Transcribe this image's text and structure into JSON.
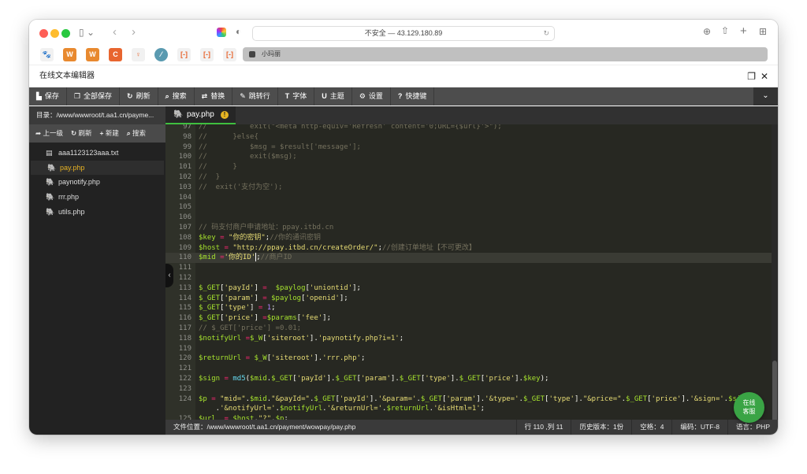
{
  "browser": {
    "url": "不安全 — 43.129.180.89",
    "tab_title": "小玛丽",
    "bookmarks": [
      "baidu",
      "W",
      "W",
      "C",
      "lightbulb",
      "code",
      "[-]",
      "[-]",
      "[-]"
    ]
  },
  "app": {
    "title": "在线文本编辑器"
  },
  "toolbar": [
    {
      "icon": "save-icon",
      "glyph": "▙",
      "label": "保存"
    },
    {
      "icon": "save-all-icon",
      "glyph": "❐",
      "label": "全部保存"
    },
    {
      "icon": "refresh-icon",
      "glyph": "↻",
      "label": "刷新"
    },
    {
      "icon": "search-icon",
      "glyph": "⌕",
      "label": "搜索"
    },
    {
      "icon": "replace-icon",
      "glyph": "⇄",
      "label": "替换"
    },
    {
      "icon": "goto-line-icon",
      "glyph": "✎",
      "label": "跳转行"
    },
    {
      "icon": "font-icon",
      "glyph": "T",
      "label": "字体"
    },
    {
      "icon": "theme-icon",
      "glyph": "U",
      "label": "主题"
    },
    {
      "icon": "settings-icon",
      "glyph": "⚙",
      "label": "设置"
    },
    {
      "icon": "shortcut-icon",
      "glyph": "?",
      "label": "快捷键"
    }
  ],
  "sidebar": {
    "path": "目录：/www/wwwroot/t.aa1.cn/payme...",
    "actions": [
      {
        "glyph": "➦",
        "label": "上一级"
      },
      {
        "glyph": "↻",
        "label": "刷新"
      },
      {
        "glyph": "+",
        "label": "新建"
      },
      {
        "glyph": "⌕",
        "label": "搜索"
      }
    ],
    "files": [
      {
        "name": "aaa1123123aaa.txt",
        "type": "txt"
      },
      {
        "name": "pay.php",
        "type": "php",
        "active": true
      },
      {
        "name": "paynotify.php",
        "type": "php"
      },
      {
        "name": "rrr.php",
        "type": "php"
      },
      {
        "name": "utils.php",
        "type": "php"
      }
    ]
  },
  "editor": {
    "tab": "pay.php",
    "current_line": 110,
    "lines": [
      {
        "n": "97",
        "t": [
          [
            "c",
            "//          exit(\"<meta http-equiv='Refresh' content='0;URL={$url}'>\");"
          ]
        ]
      },
      {
        "n": "98",
        "t": [
          [
            "c",
            "//      }else{"
          ]
        ]
      },
      {
        "n": "99",
        "t": [
          [
            "c",
            "//          $msg = $result['message'];"
          ]
        ]
      },
      {
        "n": "100",
        "t": [
          [
            "c",
            "//          exit($msg);"
          ]
        ]
      },
      {
        "n": "101",
        "t": [
          [
            "c",
            "//      }"
          ]
        ]
      },
      {
        "n": "102",
        "t": [
          [
            "c",
            "//  }"
          ]
        ]
      },
      {
        "n": "103",
        "t": [
          [
            "c",
            "//  exit('支付为空');"
          ]
        ]
      },
      {
        "n": "104",
        "t": []
      },
      {
        "n": "105",
        "t": []
      },
      {
        "n": "106",
        "t": []
      },
      {
        "n": "107",
        "t": [
          [
            "c",
            "// 码支付商户申请地址：ppay.itbd.cn"
          ]
        ]
      },
      {
        "n": "108",
        "t": [
          [
            "v",
            "$key"
          ],
          [
            "o",
            " = "
          ],
          [
            "s",
            "\"你的密钥\""
          ],
          [
            "p",
            ";"
          ],
          [
            "c",
            "//你的通讯密钥"
          ]
        ]
      },
      {
        "n": "109",
        "t": [
          [
            "v",
            "$host"
          ],
          [
            "o",
            " = "
          ],
          [
            "s",
            "\"http://ppay.itbd.cn/createOrder/\""
          ],
          [
            "p",
            ";"
          ],
          [
            "c",
            "//创建订单地址【不可更改】"
          ]
        ]
      },
      {
        "n": "110",
        "t": [
          [
            "v",
            "$mid"
          ],
          [
            "o",
            " ="
          ],
          [
            "s",
            "'你的ID'"
          ],
          [
            "cur",
            ""
          ],
          [
            "p",
            ";"
          ],
          [
            "c",
            "//商户ID"
          ]
        ]
      },
      {
        "n": "111",
        "t": []
      },
      {
        "n": "112",
        "t": []
      },
      {
        "n": "113",
        "t": [
          [
            "v",
            "$_GET"
          ],
          [
            "p",
            "["
          ],
          [
            "s",
            "'payId'"
          ],
          [
            "p",
            "]"
          ],
          [
            "o",
            " =  "
          ],
          [
            "v",
            "$paylog"
          ],
          [
            "p",
            "["
          ],
          [
            "s",
            "'uniontid'"
          ],
          [
            "p",
            "];"
          ]
        ]
      },
      {
        "n": "114",
        "t": [
          [
            "v",
            "$_GET"
          ],
          [
            "p",
            "["
          ],
          [
            "s",
            "'param'"
          ],
          [
            "p",
            "]"
          ],
          [
            "o",
            " = "
          ],
          [
            "v",
            "$paylog"
          ],
          [
            "p",
            "["
          ],
          [
            "s",
            "'openid'"
          ],
          [
            "p",
            "];"
          ]
        ]
      },
      {
        "n": "115",
        "t": [
          [
            "v",
            "$_GET"
          ],
          [
            "p",
            "["
          ],
          [
            "s",
            "'type'"
          ],
          [
            "p",
            "]"
          ],
          [
            "o",
            " = "
          ],
          [
            "n",
            "1"
          ],
          [
            "p",
            ";"
          ]
        ]
      },
      {
        "n": "116",
        "t": [
          [
            "v",
            "$_GET"
          ],
          [
            "p",
            "["
          ],
          [
            "s",
            "'price'"
          ],
          [
            "p",
            "]"
          ],
          [
            "o",
            " ="
          ],
          [
            "v",
            "$params"
          ],
          [
            "p",
            "["
          ],
          [
            "s",
            "'fee'"
          ],
          [
            "p",
            "];"
          ]
        ]
      },
      {
        "n": "117",
        "t": [
          [
            "c",
            "// $_GET['price'] =0.01;"
          ]
        ]
      },
      {
        "n": "118",
        "t": [
          [
            "v",
            "$notifyUrl"
          ],
          [
            "o",
            " ="
          ],
          [
            "v",
            "$_W"
          ],
          [
            "p",
            "["
          ],
          [
            "s",
            "'siteroot'"
          ],
          [
            "p",
            "]."
          ],
          [
            "s",
            "'paynotify.php?i=1'"
          ],
          [
            "p",
            ";"
          ]
        ]
      },
      {
        "n": "119",
        "t": []
      },
      {
        "n": "120",
        "t": [
          [
            "v",
            "$returnUrl"
          ],
          [
            "o",
            " = "
          ],
          [
            "v",
            "$_W"
          ],
          [
            "p",
            "["
          ],
          [
            "s",
            "'siteroot'"
          ],
          [
            "p",
            "]."
          ],
          [
            "s",
            "'rrr.php'"
          ],
          [
            "p",
            ";"
          ]
        ]
      },
      {
        "n": "121",
        "t": []
      },
      {
        "n": "122",
        "t": [
          [
            "v",
            "$sign"
          ],
          [
            "o",
            " = "
          ],
          [
            "f",
            "md5"
          ],
          [
            "p",
            "("
          ],
          [
            "v",
            "$mid"
          ],
          [
            "p",
            "."
          ],
          [
            "v",
            "$_GET"
          ],
          [
            "p",
            "["
          ],
          [
            "s",
            "'payId'"
          ],
          [
            "p",
            "]."
          ],
          [
            "v",
            "$_GET"
          ],
          [
            "p",
            "["
          ],
          [
            "s",
            "'param'"
          ],
          [
            "p",
            "]."
          ],
          [
            "v",
            "$_GET"
          ],
          [
            "p",
            "["
          ],
          [
            "s",
            "'type'"
          ],
          [
            "p",
            "]."
          ],
          [
            "v",
            "$_GET"
          ],
          [
            "p",
            "["
          ],
          [
            "s",
            "'price'"
          ],
          [
            "p",
            "]."
          ],
          [
            "v",
            "$key"
          ],
          [
            "p",
            ");"
          ]
        ]
      },
      {
        "n": "123",
        "t": []
      },
      {
        "n": "124",
        "t": [
          [
            "v",
            "$p"
          ],
          [
            "o",
            " = "
          ],
          [
            "s",
            "\"mid=\""
          ],
          [
            "p",
            "."
          ],
          [
            "v",
            "$mid"
          ],
          [
            "p",
            "."
          ],
          [
            "s",
            "\"&payId=\""
          ],
          [
            "p",
            "."
          ],
          [
            "v",
            "$_GET"
          ],
          [
            "p",
            "["
          ],
          [
            "s",
            "'payId'"
          ],
          [
            "p",
            "]."
          ],
          [
            "s",
            "'&param='"
          ],
          [
            "p",
            "."
          ],
          [
            "v",
            "$_GET"
          ],
          [
            "p",
            "["
          ],
          [
            "s",
            "'param'"
          ],
          [
            "p",
            "]."
          ],
          [
            "s",
            "'&type='"
          ],
          [
            "p",
            "."
          ],
          [
            "v",
            "$_GET"
          ],
          [
            "p",
            "["
          ],
          [
            "s",
            "'type'"
          ],
          [
            "p",
            "]."
          ],
          [
            "s",
            "\"&price=\""
          ],
          [
            "p",
            "."
          ],
          [
            "v",
            "$_GET"
          ],
          [
            "p",
            "["
          ],
          [
            "s",
            "'price'"
          ],
          [
            "p",
            "]."
          ],
          [
            "s",
            "'&sign='"
          ],
          [
            "p",
            "."
          ],
          [
            "v",
            "$sign"
          ]
        ]
      },
      {
        "n": "",
        "t": [
          [
            "p",
            "    ."
          ],
          [
            "s",
            "'&notifyUrl='"
          ],
          [
            "p",
            "."
          ],
          [
            "v",
            "$notifyUrl"
          ],
          [
            "p",
            "."
          ],
          [
            "s",
            "'&returnUrl='"
          ],
          [
            "p",
            "."
          ],
          [
            "v",
            "$returnUrl"
          ],
          [
            "p",
            "."
          ],
          [
            "s",
            "'&isHtml=1'"
          ],
          [
            "p",
            ";"
          ]
        ]
      },
      {
        "n": "125",
        "t": [
          [
            "v",
            "$url_"
          ],
          [
            "o",
            " = "
          ],
          [
            "v",
            "$host"
          ],
          [
            "p",
            "."
          ],
          [
            "s",
            "\"?\""
          ],
          [
            "p",
            "."
          ],
          [
            "v",
            "$p"
          ],
          [
            "p",
            ";"
          ]
        ]
      }
    ]
  },
  "status": {
    "file_path": "文件位置：/www/wwwroot/t.aa1.cn/payment/wowpay/pay.php",
    "position": "行 110 ,列 11",
    "history": "历史版本：1份",
    "indent": "空格：4",
    "encoding": "编码：UTF-8",
    "language": "语言：PHP"
  },
  "chat": {
    "line1": "在线",
    "line2": "客服",
    "color": "#3aa445"
  }
}
